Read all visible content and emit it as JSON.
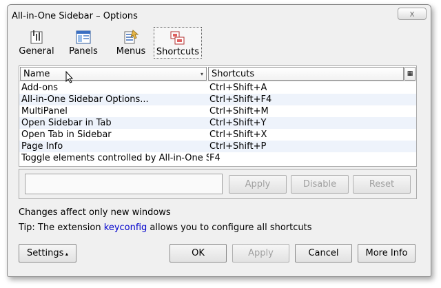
{
  "window": {
    "title": "All-in-One Sidebar – Options",
    "close_label": "x"
  },
  "pane_tabs": [
    {
      "label": "General",
      "icon": "general-icon"
    },
    {
      "label": "Panels",
      "icon": "panels-icon"
    },
    {
      "label": "Menus",
      "icon": "menus-icon"
    },
    {
      "label": "Shortcuts",
      "icon": "shortcuts-icon",
      "selected": true
    }
  ],
  "list": {
    "columns": {
      "name": "Name",
      "shortcut": "Shortcuts"
    },
    "rows": [
      {
        "name": "Add-ons",
        "shortcut": "Ctrl+Shift+A"
      },
      {
        "name": "All-in-One Sidebar Options...",
        "shortcut": "Ctrl+Shift+F4"
      },
      {
        "name": "MultiPanel",
        "shortcut": "Ctrl+Shift+M"
      },
      {
        "name": "Open Sidebar in Tab",
        "shortcut": "Ctrl+Shift+Y"
      },
      {
        "name": "Open Tab in Sidebar",
        "shortcut": "Ctrl+Shift+X"
      },
      {
        "name": "Page Info",
        "shortcut": "Ctrl+Shift+P"
      },
      {
        "name": "Toggle elements controlled by All-in-One Si...",
        "shortcut": "F4"
      }
    ]
  },
  "editor": {
    "input_value": "",
    "apply_label": "Apply",
    "disable_label": "Disable",
    "reset_label": "Reset"
  },
  "notes": {
    "changes": "Changes affect only new windows",
    "tip_prefix": "Tip: The extension ",
    "tip_link": "keyconfig",
    "tip_suffix": " allows you to configure all shortcuts"
  },
  "footer": {
    "settings_label": "Settings",
    "ok_label": "OK",
    "apply_label": "Apply",
    "cancel_label": "Cancel",
    "more_info_label": "More Info"
  },
  "colors": {
    "link": "#0000cc",
    "alt_row": "#eef3fb"
  }
}
